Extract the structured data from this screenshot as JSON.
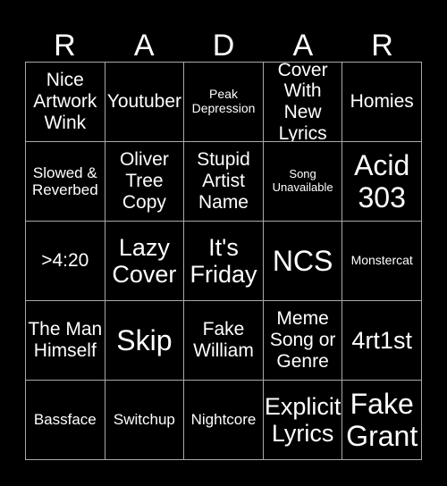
{
  "theme": {
    "background": "#000000",
    "text_color": "#ffffff",
    "grid_line_color": "#a9a9a9"
  },
  "header": {
    "letters": [
      "R",
      "A",
      "D",
      "A",
      "R"
    ],
    "title": "RADAR"
  },
  "grid": {
    "rows": 5,
    "columns": 5,
    "cells": [
      {
        "label": "Nice Artwork Wink",
        "size": "fs-md"
      },
      {
        "label": "Youtuber",
        "size": "fs-md"
      },
      {
        "label": "Peak Depression",
        "size": "fs-xs"
      },
      {
        "label": "Cover With New Lyrics",
        "size": "fs-md"
      },
      {
        "label": "Homies",
        "size": "fs-md"
      },
      {
        "label": "Slowed & Reverbed",
        "size": "fs-sm"
      },
      {
        "label": "Oliver Tree Copy",
        "size": "fs-md"
      },
      {
        "label": "Stupid Artist Name",
        "size": "fs-md"
      },
      {
        "label": "Song Unavailable",
        "size": "fs-xxs"
      },
      {
        "label": "Acid 303",
        "size": "fs-xl"
      },
      {
        "label": ">4:20",
        "size": "fs-md"
      },
      {
        "label": "Lazy Cover",
        "size": "fs-lg"
      },
      {
        "label": "It's Friday",
        "size": "fs-lg"
      },
      {
        "label": "NCS",
        "size": "fs-xl"
      },
      {
        "label": "Monstercat",
        "size": "fs-xs"
      },
      {
        "label": "The Man Himself",
        "size": "fs-md"
      },
      {
        "label": "Skip",
        "size": "fs-xl"
      },
      {
        "label": "Fake William",
        "size": "fs-md"
      },
      {
        "label": "Meme Song or Genre",
        "size": "fs-md"
      },
      {
        "label": "4rt1st",
        "size": "fs-lg"
      },
      {
        "label": "Bassface",
        "size": "fs-sm"
      },
      {
        "label": "Switchup",
        "size": "fs-sm"
      },
      {
        "label": "Nightcore",
        "size": "fs-sm"
      },
      {
        "label": "Explicit Lyrics",
        "size": "fs-lg"
      },
      {
        "label": "Fake Grant",
        "size": "fs-xl"
      }
    ]
  }
}
